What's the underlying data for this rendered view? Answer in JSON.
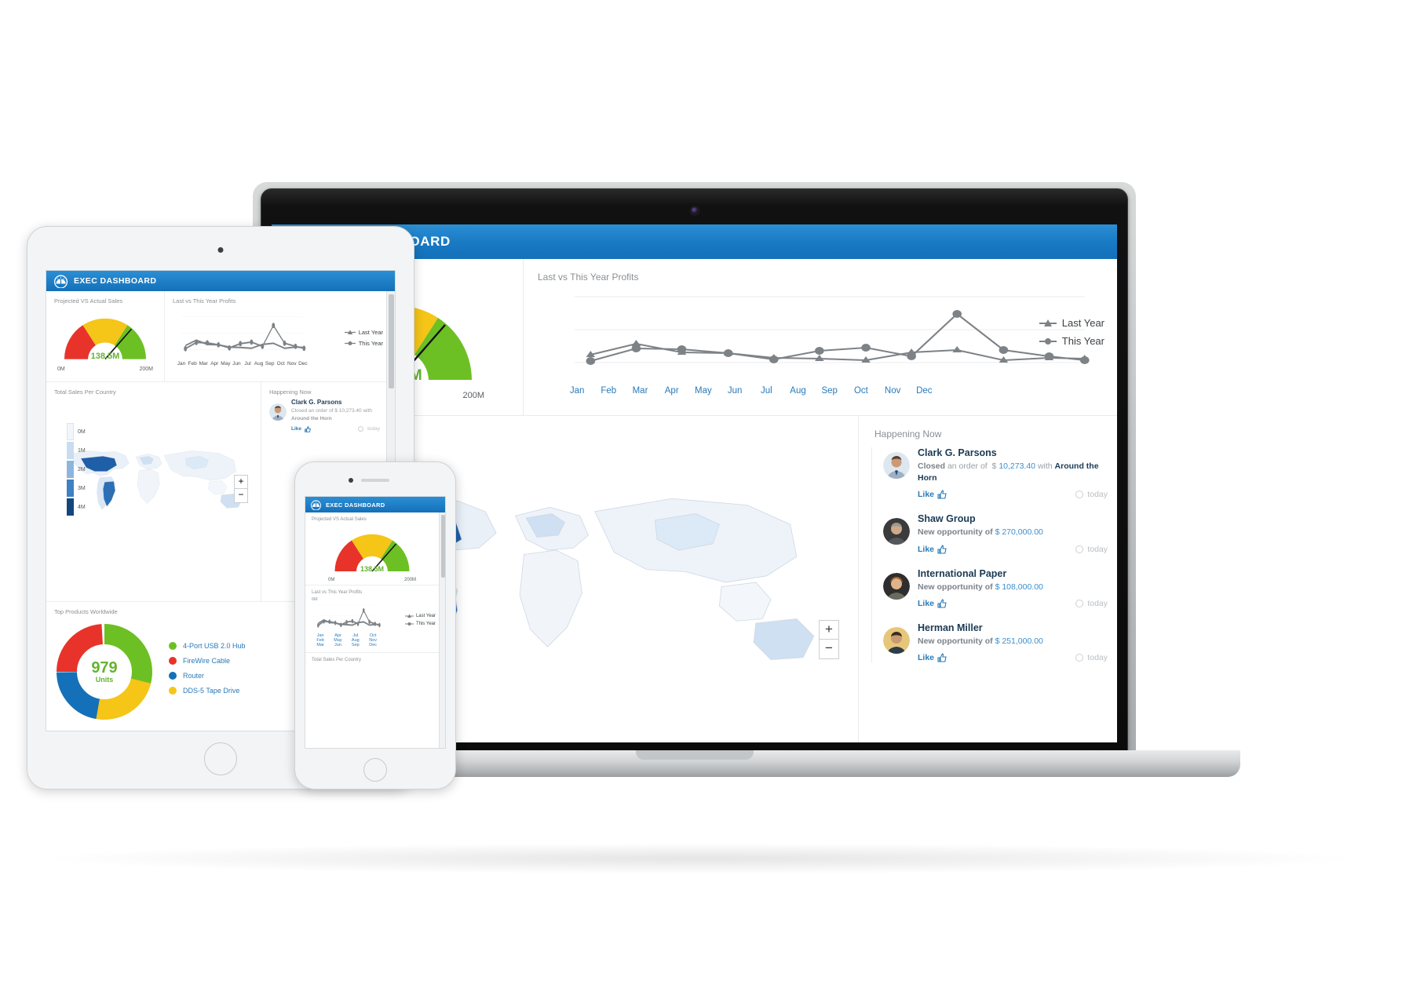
{
  "app": {
    "title": "EXEC DASHBOARD",
    "logo_icon": "gauge-speedometer-icon",
    "header_color": "#1879c4"
  },
  "panels": {
    "gauge_label": "Projected VS Actual Sales",
    "line_label": "Last vs This Year Profits",
    "map_label": "Total Sales Per Country",
    "feed_label": "Happening Now",
    "products_label": "Top Products Worldwide"
  },
  "gauge": {
    "value_text": "138.5M",
    "min_label": "0M",
    "max_label": "200M",
    "value": 138.5,
    "min": 0,
    "max": 200,
    "colors": {
      "low": "#e8332a",
      "mid": "#f5c518",
      "high": "#6cc024",
      "needle": "#111111",
      "value_text": "#65b32e"
    }
  },
  "legend": {
    "last_year": "Last Year",
    "this_year": "This Year"
  },
  "map": {
    "zoom_in": "+",
    "zoom_out": "−",
    "scale_labels": [
      "0M",
      "1M",
      "2M",
      "3M",
      "4M"
    ],
    "scale_colors": [
      "#f2f6fb",
      "#c9dcf0",
      "#8cb6e0",
      "#3f7fc4",
      "#14457f"
    ]
  },
  "products": {
    "center_value": "979",
    "center_unit": "Units",
    "items": [
      {
        "label": "4-Port USB 2.0 Hub",
        "color": "#6cc024",
        "value": 30
      },
      {
        "label": "FireWire Cable",
        "color": "#e8332a",
        "value": 24
      },
      {
        "label": "Router",
        "color": "#1470b9",
        "value": 22
      },
      {
        "label": "DDS-5 Tape Drive",
        "color": "#f5c518",
        "value": 24
      }
    ]
  },
  "feed": {
    "like_label": "Like",
    "time_label": "today",
    "items": [
      {
        "name": "Clark G. Parsons",
        "verb": "Closed",
        "text_mid": "an order of  $ 10,273.40 with",
        "amount": "",
        "company": "Around the Horn",
        "avatar": "avatar-man-suit"
      },
      {
        "name": "Shaw Group",
        "verb": "New opportunity of",
        "text_mid": "",
        "amount": "$ 270,000.00",
        "company": "",
        "avatar": "avatar-man-gray"
      },
      {
        "name": "International Paper",
        "verb": "New opportunity of",
        "text_mid": "",
        "amount": "$ 108,000.00",
        "company": "",
        "avatar": "avatar-woman-curly"
      },
      {
        "name": "Herman Miller",
        "verb": "New opportunity of",
        "text_mid": "",
        "amount": "$ 251,000.00",
        "company": "",
        "avatar": "avatar-man-dark"
      }
    ]
  },
  "chart_data": {
    "type": "line",
    "title": "Last vs This Year Profits",
    "xlabel": "",
    "ylabel": "",
    "grid": true,
    "legend_position": "right",
    "categories": [
      "Jan",
      "Feb",
      "Mar",
      "Apr",
      "May",
      "Jun",
      "Jul",
      "Aug",
      "Sep",
      "Oct",
      "Nov",
      "Dec"
    ],
    "ylim": [
      0,
      8
    ],
    "series": [
      {
        "name": "Last Year",
        "marker": "triangle",
        "color": "#7d8286",
        "values": [
          2.4,
          3.9,
          3.1,
          3.0,
          2.5,
          2.4,
          2.2,
          3.1,
          3.4,
          2.2,
          2.5,
          2.4
        ]
      },
      {
        "name": "This Year",
        "marker": "circle",
        "color": "#7d8286",
        "values": [
          1.9,
          3.5,
          3.4,
          3.0,
          2.3,
          3.2,
          3.6,
          2.6,
          6.4,
          3.3,
          2.6,
          2.2
        ]
      }
    ]
  },
  "chart_data_gauge": {
    "type": "gauge",
    "title": "Projected VS Actual Sales",
    "value": 138.5,
    "min": 0,
    "max": 200,
    "bands": [
      {
        "from": 0,
        "to": 66,
        "color": "#e8332a"
      },
      {
        "from": 66,
        "to": 133,
        "color": "#f5c518"
      },
      {
        "from": 133,
        "to": 200,
        "color": "#6cc024"
      }
    ]
  },
  "chart_data_donut": {
    "type": "pie",
    "title": "Top Products Worldwide",
    "center_label": "979 Units",
    "categories": [
      "4-Port USB 2.0 Hub",
      "FireWire Cable",
      "Router",
      "DDS-5 Tape Drive"
    ],
    "values": [
      30,
      24,
      22,
      24
    ],
    "colors": [
      "#6cc024",
      "#e8332a",
      "#1470b9",
      "#f5c518"
    ]
  },
  "chart_data_map": {
    "type": "heatmap",
    "title": "Total Sales Per Country",
    "scale": [
      "0M",
      "1M",
      "2M",
      "3M",
      "4M"
    ],
    "highlighted_regions": [
      "United States",
      "Brazil",
      "Australia",
      "Canada",
      "France",
      "Germany",
      "India",
      "Mexico"
    ]
  }
}
